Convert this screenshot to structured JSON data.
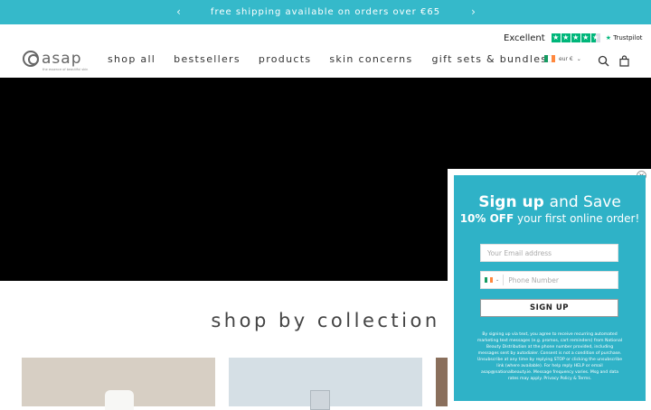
{
  "announcement": {
    "text": "free shipping available on orders over €65",
    "prev_icon": "chevron-left-icon",
    "next_icon": "chevron-right-icon"
  },
  "trustpilot": {
    "rating_text": "Excellent",
    "brand": "Trustpilot",
    "rating": 4.5,
    "max": 5
  },
  "header": {
    "logo_text": "asap",
    "logo_tagline": "the essence of beautiful skin",
    "nav": [
      "shop all",
      "bestsellers",
      "products",
      "skin concerns",
      "gift sets & bundles"
    ],
    "currency": "eur €",
    "flag_colors": [
      "#169b62",
      "#ffffff",
      "#ff883e"
    ],
    "icons": [
      "search-icon",
      "bag-icon"
    ]
  },
  "hero": {
    "color": "#000000"
  },
  "collection": {
    "title": "shop by collection"
  },
  "popup": {
    "title_bold": "Sign up",
    "title_rest": "and Save",
    "sub_bold": "10% OFF",
    "sub_rest": "your first online order!",
    "email_placeholder": "Your Email address",
    "phone_placeholder": "Phone Number",
    "button_label": "SIGN UP",
    "close_label": "×",
    "legal": "By signing up via text, you agree to receive recurring automated marketing text messages (e.g. promos, cart reminders) from National Beauty Distribution at the phone number provided, including messages sent by autodialer. Consent is not a condition of purchase. Unsubscribe at any time by replying STOP or clicking the unsubscribe link (where available). For help reply HELP or email asap@nationalbeauty.ie. Message frequency varies. Msg and data rates may apply. Privacy Policy & Terms.",
    "accent": "#2fb2c7"
  }
}
